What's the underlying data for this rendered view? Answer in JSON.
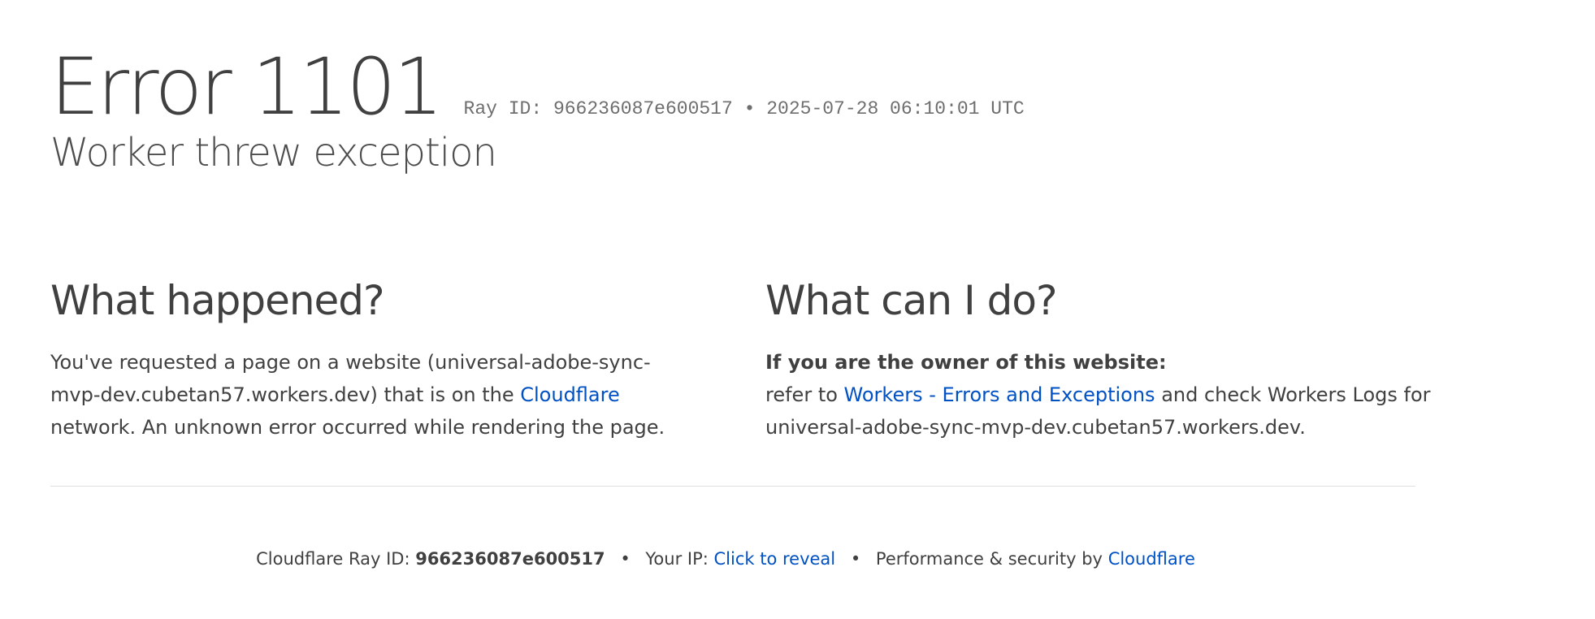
{
  "header": {
    "error_code": "Error 1101",
    "ray_label": "Ray ID:",
    "ray_id": "966236087e600517",
    "bullet": "•",
    "timestamp": "2025-07-28 06:10:01 UTC",
    "subtitle": "Worker threw exception"
  },
  "what_happened": {
    "heading": "What happened?",
    "text_before_link": "You've requested a page on a website (universal-adobe-sync-mvp-dev.cubetan57.workers.dev) that is on the ",
    "link": "Cloudflare",
    "text_after_link": " network. An unknown error occurred while rendering the page."
  },
  "what_can_i_do": {
    "heading": "What can I do?",
    "owner_label": "If you are the owner of this website:",
    "text_before_link": "refer to ",
    "link": "Workers - Errors and Exceptions",
    "text_after_link": " and check Workers Logs for universal-adobe-sync-mvp-dev.cubetan57.workers.dev."
  },
  "footer": {
    "ray_label": "Cloudflare Ray ID:",
    "ray_id": "966236087e600517",
    "separator": "•",
    "ip_label": "Your IP:",
    "ip_link": "Click to reveal",
    "perf_label": "Performance & security by",
    "perf_link": "Cloudflare"
  },
  "colors": {
    "text": "#404040",
    "link": "#0051c3",
    "divider": "#e0e0e0"
  }
}
